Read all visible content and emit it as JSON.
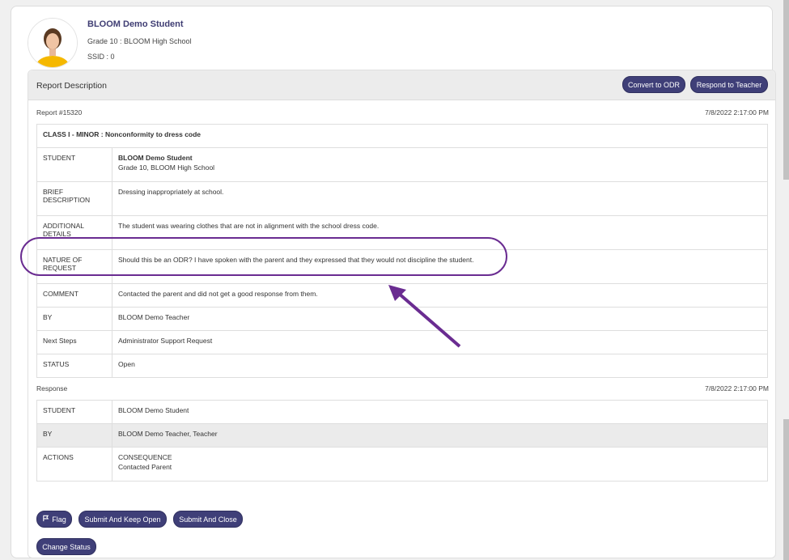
{
  "student": {
    "name": "BLOOM Demo Student",
    "grade_line": "Grade 10 : BLOOM High School",
    "ssid_line": "SSID : 0"
  },
  "panel": {
    "title": "Report Description",
    "convert_btn": "Convert to ODR",
    "respond_btn": "Respond to Teacher"
  },
  "report": {
    "number": "Report #15320",
    "timestamp": "7/8/2022 2:17:00 PM",
    "heading": "CLASS I - MINOR : Nonconformity to dress code",
    "rows": {
      "student_label": "STUDENT",
      "student_name": "BLOOM Demo Student",
      "student_school": "Grade 10, BLOOM High School",
      "brief_label": "BRIEF DESCRIPTION",
      "brief_value": "Dressing inappropriately at school.",
      "additional_label": "ADDITIONAL DETAILS",
      "additional_value": "The student was wearing clothes that are not in alignment with the school dress code.",
      "nature_label": "NATURE OF REQUEST",
      "nature_value": "Should this be an ODR? I have spoken with the parent and they expressed that they would not discipline the student.",
      "comment_label": "COMMENT",
      "comment_value": "Contacted the parent and did not get a good response from them.",
      "by_label": "BY",
      "by_value": "BLOOM Demo Teacher",
      "next_label": "Next Steps",
      "next_value": "Administrator Support Request",
      "status_label": "STATUS",
      "status_value": "Open"
    }
  },
  "response": {
    "label": "Response",
    "timestamp": "7/8/2022 2:17:00 PM",
    "rows": {
      "student_label": "STUDENT",
      "student_value": "BLOOM Demo Student",
      "by_label": "BY",
      "by_value": "BLOOM Demo Teacher, Teacher",
      "actions_label": "ACTIONS",
      "actions_line1": "CONSEQUENCE",
      "actions_line2": "Contacted Parent"
    }
  },
  "footer": {
    "flag": "Flag",
    "submit_keep_open": "Submit And Keep Open",
    "submit_close": "Submit And Close",
    "change_status": "Change Status"
  },
  "colors": {
    "button": "#3f3f78",
    "annotation": "#6a2c91",
    "header_bg": "#ececec"
  }
}
